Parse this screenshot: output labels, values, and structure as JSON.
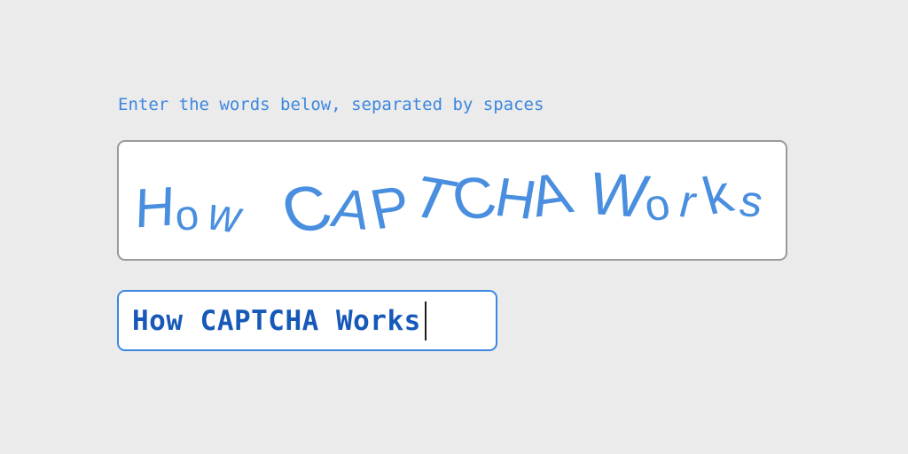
{
  "prompt": {
    "instruction": "Enter the words below, separated by spaces"
  },
  "captcha": {
    "image_text": "How CAPTCHA Works",
    "glyph_color": "#4a8fdf"
  },
  "answer_field": {
    "value": "How CAPTCHA Works",
    "text_color": "#1659b8",
    "border_color": "#3d87e0"
  },
  "colors": {
    "background": "#ebebeb",
    "accent": "#3d87e0",
    "captcha_border": "#9a9a9a"
  }
}
